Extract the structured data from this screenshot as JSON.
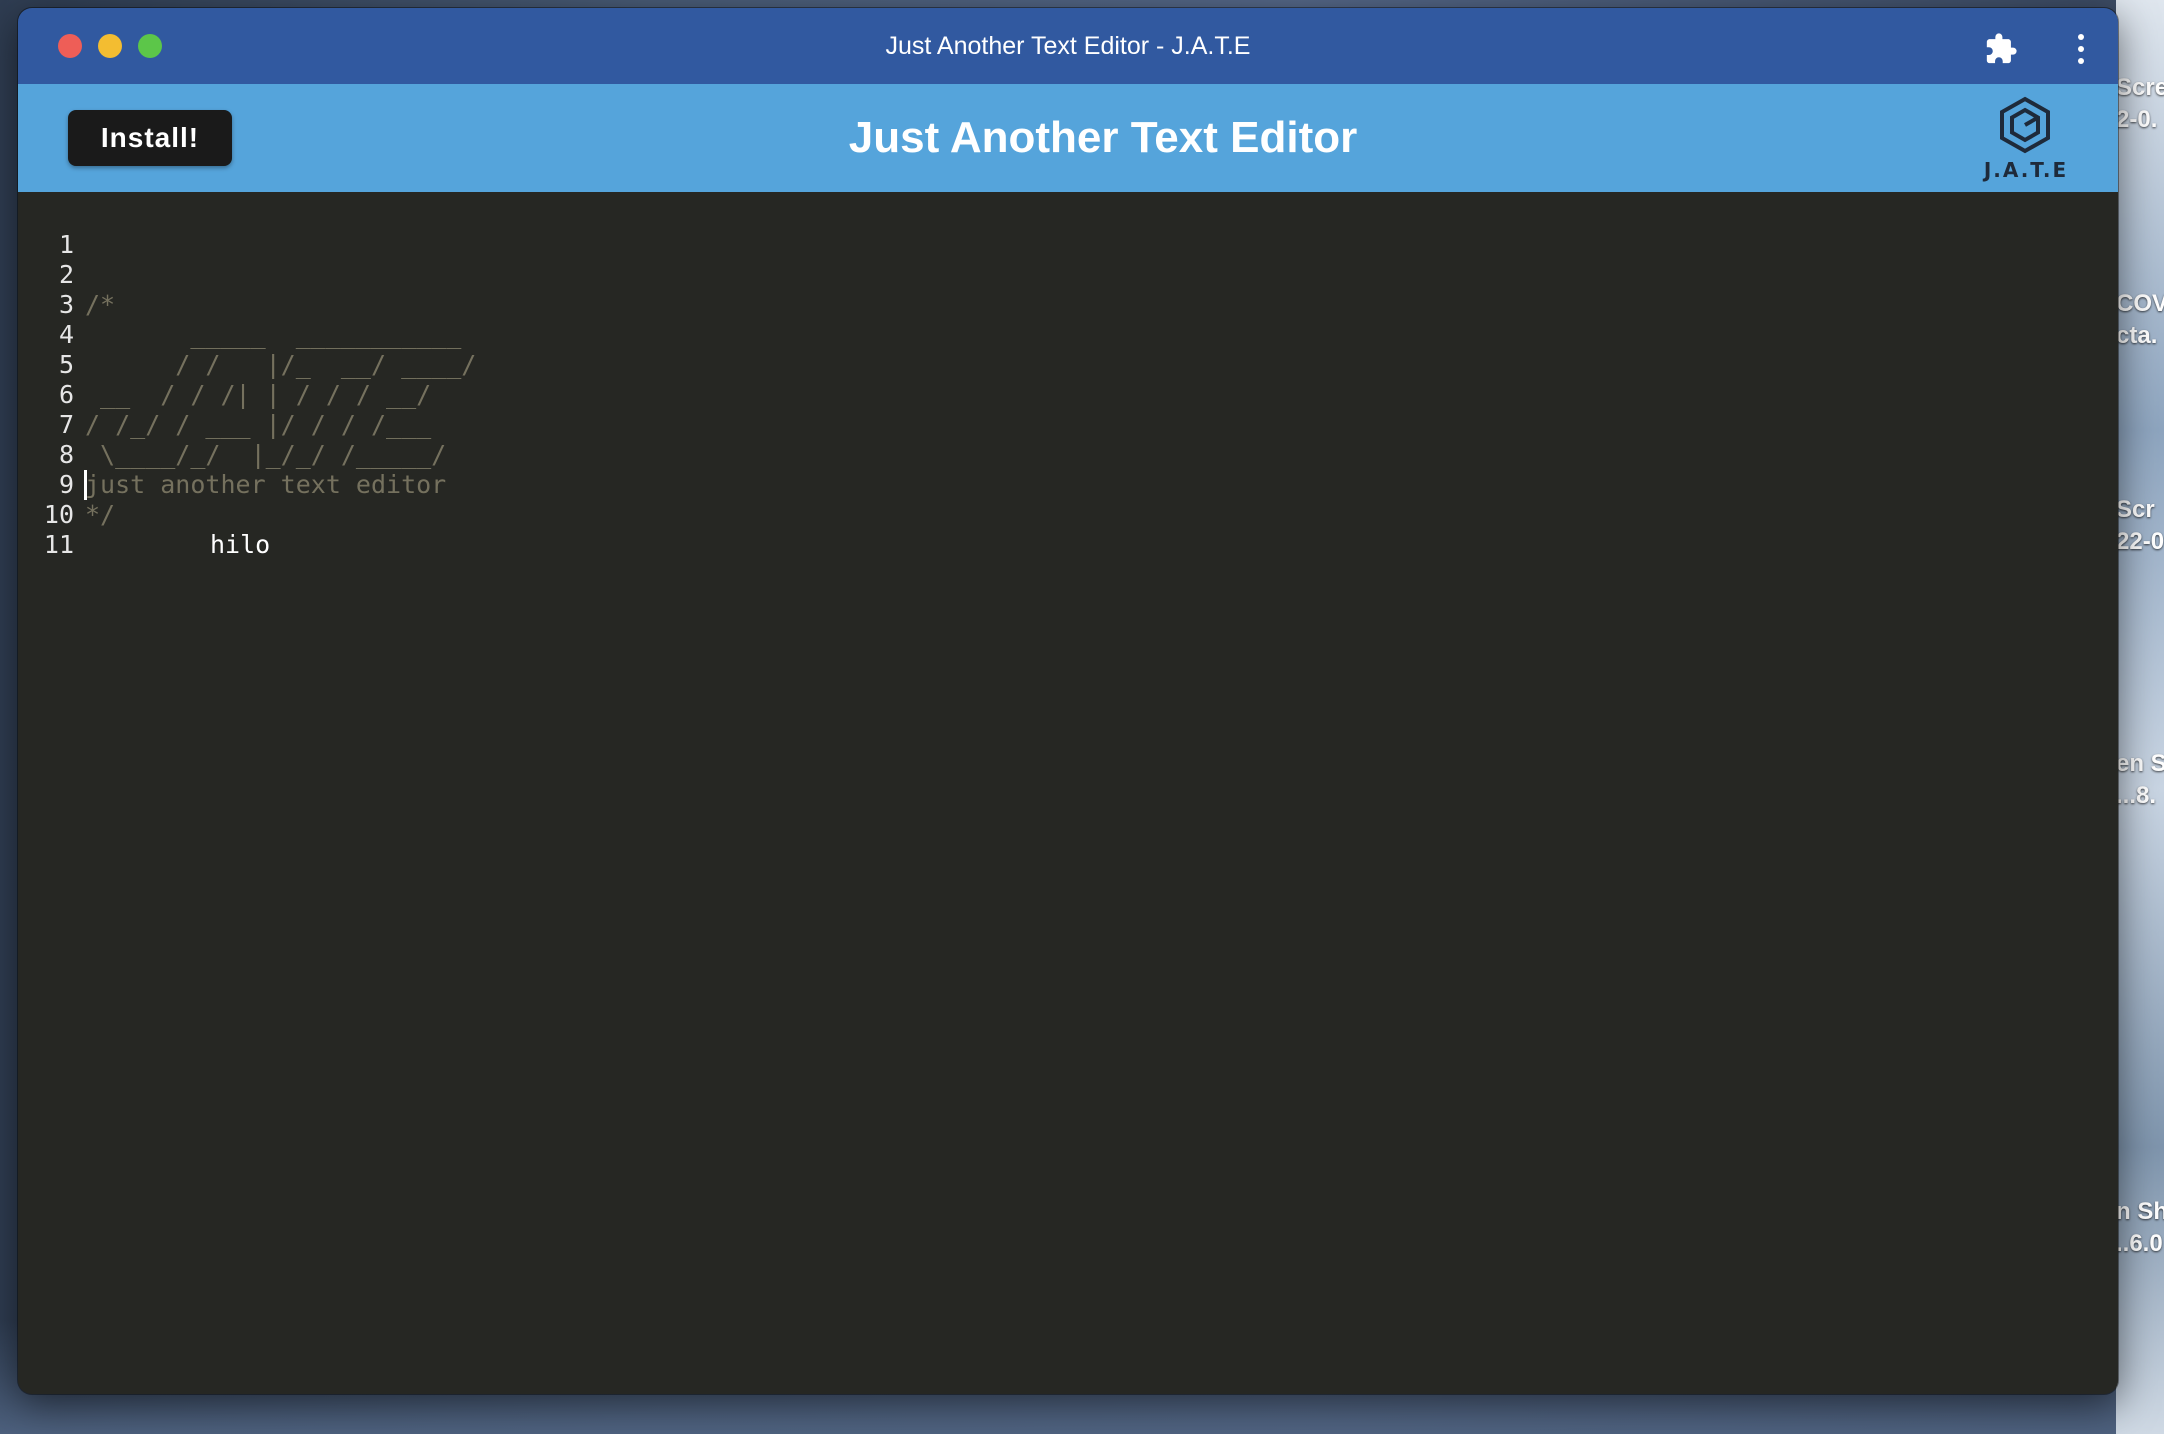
{
  "window": {
    "title": "Just Another Text Editor - J.A.T.E"
  },
  "header": {
    "install_label": "Install!",
    "title": "Just Another Text Editor",
    "logo_text": "J.A.T.E"
  },
  "editor": {
    "lines": [
      {
        "number": "1",
        "text": ""
      },
      {
        "number": "2",
        "text": "/*"
      },
      {
        "number": "3",
        "text": "       _____  ___________"
      },
      {
        "number": "4",
        "text": "      / /   |/_  __/ ____/"
      },
      {
        "number": "5",
        "text": " __  / / /| | / / / __/"
      },
      {
        "number": "6",
        "text": "/ /_/ / ___ |/ / / /___"
      },
      {
        "number": "7",
        "text": " \\____/_/  |_/_/ /_____/"
      },
      {
        "number": "8",
        "text": "just another text editor"
      },
      {
        "number": "9",
        "text": "*/",
        "extra": "hilo"
      },
      {
        "number": "10",
        "text": ""
      },
      {
        "number": "11",
        "text": ""
      }
    ]
  },
  "desktop": {
    "labels": [
      "Scre",
      "2-0.",
      "COV",
      "cta.",
      "Scr",
      "22-0",
      "en S",
      "...8.",
      "n Sh",
      "..6.0"
    ]
  },
  "colors": {
    "titlebar": "#3159a0",
    "header": "#55a4db",
    "editor_bg": "#262723",
    "comment": "#75715e"
  }
}
